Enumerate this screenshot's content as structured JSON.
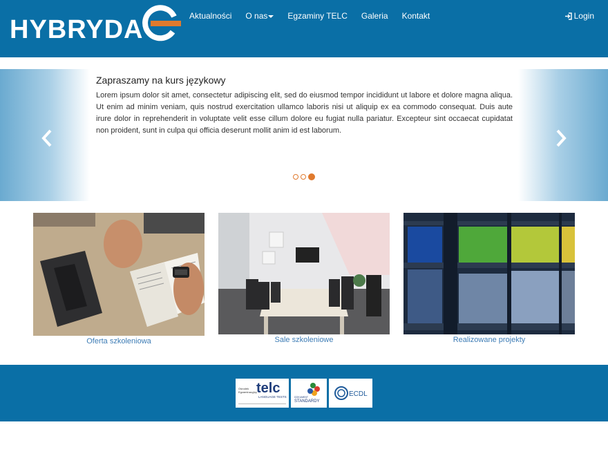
{
  "brand": {
    "name": "HYBRYDA"
  },
  "nav": {
    "items": [
      "Aktualności",
      "O nas",
      "Egzaminy TELC",
      "Galeria",
      "Kontakt"
    ],
    "login": "Login"
  },
  "carousel": {
    "title": "Zapraszamy na kurs językowy",
    "text": "Lorem ipsum dolor sit amet, consectetur adipiscing elit, sed do eiusmod tempor incididunt ut labore et dolore magna aliqua. Ut enim ad minim veniam, quis nostrud exercitation ullamco laboris nisi ut aliquip ex ea commodo consequat. Duis aute irure dolor in reprehenderit in voluptate velit esse cillum dolore eu fugiat nulla pariatur. Excepteur sint occaecat cupidatat non proident, sunt in culpa qui officia deserunt mollit anim id est laborum.",
    "slides": 3,
    "active_slide": 3
  },
  "cards": [
    {
      "label": "Oferta szkoleniowa"
    },
    {
      "label": "Sale szkoleniowe"
    },
    {
      "label": "Realizowane projekty"
    }
  ],
  "footer": {
    "badges": [
      {
        "brand": "telc",
        "sub": "LANGUAGE TESTS",
        "left_text": "Ośrodek Egzaminacyjny"
      },
      {
        "brand": "STANDARDY",
        "sub": "DOKUMENT"
      },
      {
        "brand": "ECDL"
      }
    ]
  },
  "colors": {
    "primary": "#0a6fa6",
    "accent": "#e07a2e",
    "link": "#3d7cb5"
  }
}
